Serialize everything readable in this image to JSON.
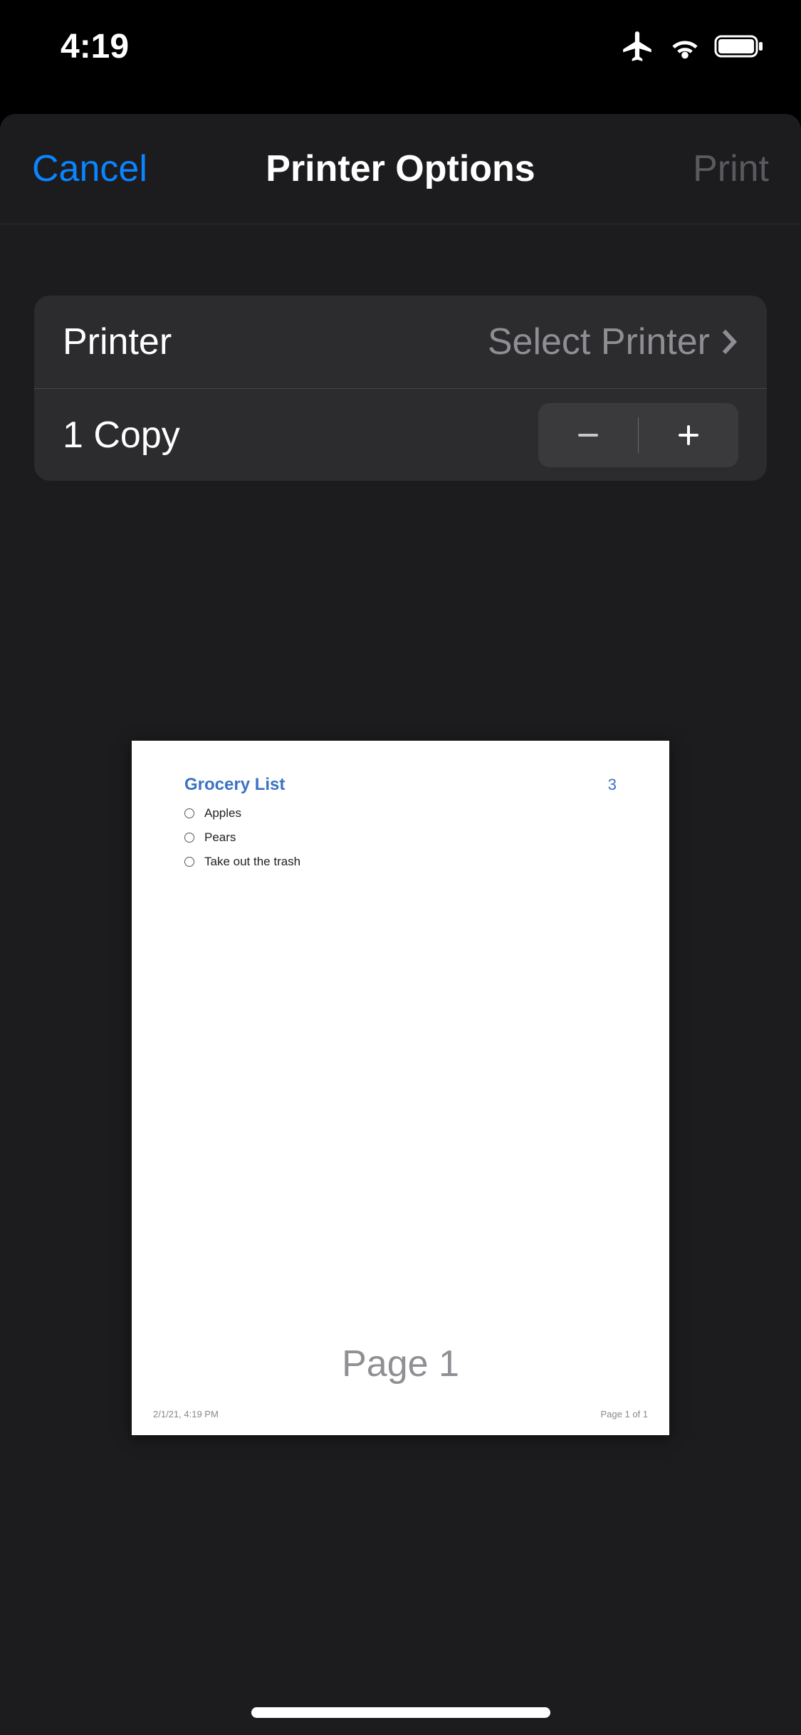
{
  "status": {
    "time": "4:19"
  },
  "nav": {
    "cancel_label": "Cancel",
    "title": "Printer Options",
    "print_label": "Print"
  },
  "settings": {
    "printer_label": "Printer",
    "printer_value": "Select Printer",
    "copies_label": "1 Copy"
  },
  "preview": {
    "page_label": "Page 1",
    "document": {
      "title": "Grocery List",
      "count": "3",
      "items": [
        "Apples",
        "Pears",
        "Take out the trash"
      ],
      "footer_left": "2/1/21, 4:19 PM",
      "footer_right": "Page 1 of 1"
    }
  }
}
